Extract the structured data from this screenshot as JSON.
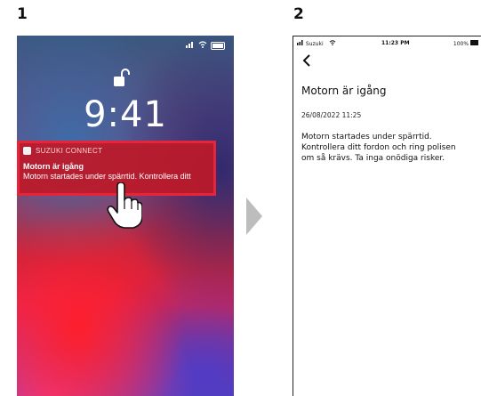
{
  "steps": {
    "one": "1",
    "two": "2"
  },
  "lock_screen": {
    "time": "9:41",
    "notification": {
      "app_name": "SUZUKI CONNECT",
      "title": "Motorn är igång",
      "body": "Motorn startades under spärrtid. Kontrollera ditt"
    }
  },
  "app_screen": {
    "status_bar": {
      "carrier": "Suzuki",
      "time": "11:23 PM",
      "battery": "100%"
    },
    "title": "Motorn är igång",
    "date": "26/08/2022 11:25",
    "body_lines": [
      "Motorn startades under spärrtid.",
      "Kontrollera ditt fordon och ring polisen",
      "om så krävs. Ta inga onödiga risker."
    ]
  },
  "colors": {
    "highlight": "#e8243a",
    "arrow": "#bdbdbd"
  },
  "icons": [
    "unlock-icon",
    "wifi-icon",
    "battery-icon",
    "signal-icon",
    "back-chevron-icon",
    "pointing-hand-icon",
    "next-arrow-icon"
  ]
}
